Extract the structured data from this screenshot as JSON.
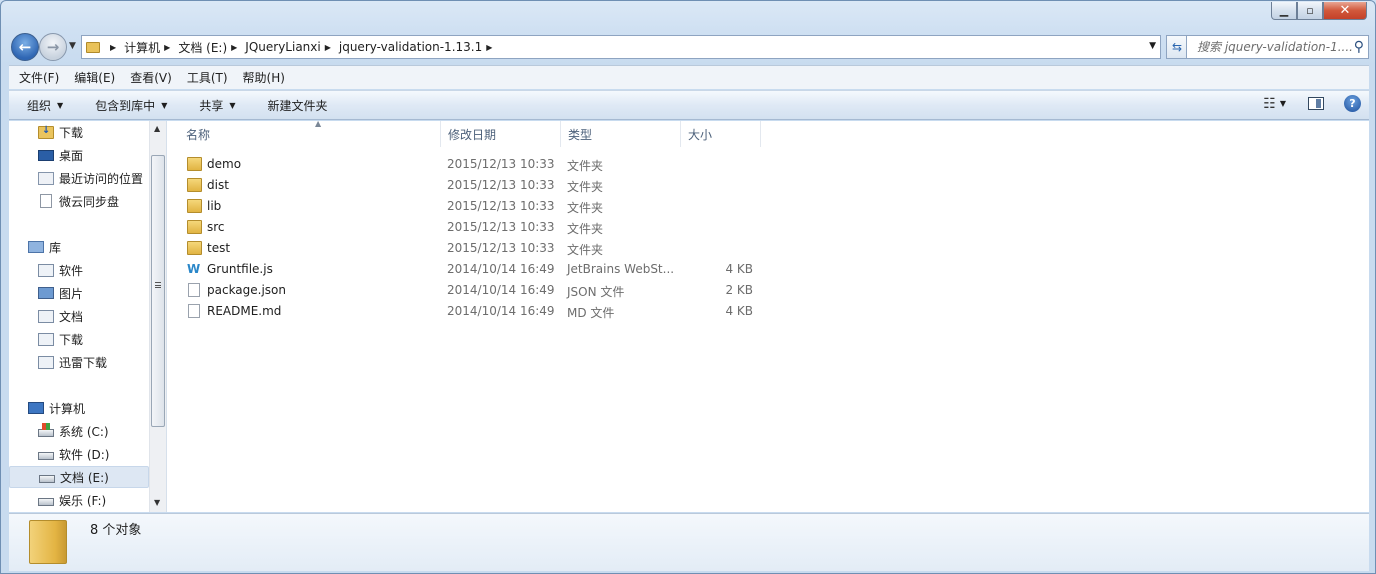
{
  "breadcrumb": [
    "计算机",
    "文档 (E:)",
    "JQueryLianxi",
    "jquery-validation-1.13.1"
  ],
  "search": {
    "placeholder": "搜索 jquery-validation-1...."
  },
  "menu": [
    "文件(F)",
    "编辑(E)",
    "查看(V)",
    "工具(T)",
    "帮助(H)"
  ],
  "toolbar": {
    "organize": "组织",
    "include_in_library": "包含到库中",
    "share": "共享",
    "new_folder": "新建文件夹"
  },
  "nav_tree": [
    {
      "label": "下载",
      "icon": "download-folder-icon",
      "indent": 1
    },
    {
      "label": "桌面",
      "icon": "desktop-icon",
      "indent": 1
    },
    {
      "label": "最近访问的位置",
      "icon": "recent-places-icon",
      "indent": 1
    },
    {
      "label": "微云同步盘",
      "icon": "document-icon",
      "indent": 1
    },
    {
      "label": "库",
      "icon": "library-icon",
      "indent": 0,
      "gap": true
    },
    {
      "label": "软件",
      "icon": "library-item-icon",
      "indent": 1
    },
    {
      "label": "图片",
      "icon": "pictures-icon",
      "indent": 1
    },
    {
      "label": "文档",
      "icon": "library-item-icon",
      "indent": 1
    },
    {
      "label": "下载",
      "icon": "library-item-icon",
      "indent": 1
    },
    {
      "label": "迅雷下载",
      "icon": "library-item-icon",
      "indent": 1
    },
    {
      "label": "计算机",
      "icon": "computer-icon",
      "indent": 0,
      "gap": true
    },
    {
      "label": "系统 (C:)",
      "icon": "system-drive-icon",
      "indent": 1
    },
    {
      "label": "软件 (D:)",
      "icon": "drive-icon",
      "indent": 1
    },
    {
      "label": "文档 (E:)",
      "icon": "drive-icon",
      "indent": 1,
      "selected": true
    },
    {
      "label": "娱乐 (F:)",
      "icon": "drive-icon",
      "indent": 1
    }
  ],
  "columns": {
    "name": "名称",
    "date": "修改日期",
    "type": "类型",
    "size": "大小"
  },
  "files": [
    {
      "name": "demo",
      "date": "2015/12/13 10:33",
      "type": "文件夹",
      "size": "",
      "icon": "folder-icon"
    },
    {
      "name": "dist",
      "date": "2015/12/13 10:33",
      "type": "文件夹",
      "size": "",
      "icon": "folder-icon"
    },
    {
      "name": "lib",
      "date": "2015/12/13 10:33",
      "type": "文件夹",
      "size": "",
      "icon": "folder-icon"
    },
    {
      "name": "src",
      "date": "2015/12/13 10:33",
      "type": "文件夹",
      "size": "",
      "icon": "folder-icon"
    },
    {
      "name": "test",
      "date": "2015/12/13 10:33",
      "type": "文件夹",
      "size": "",
      "icon": "folder-icon"
    },
    {
      "name": "Gruntfile.js",
      "date": "2014/10/14 16:49",
      "type": "JetBrains WebSt...",
      "size": "4 KB",
      "icon": "webstorm-file-icon"
    },
    {
      "name": "package.json",
      "date": "2014/10/14 16:49",
      "type": "JSON 文件",
      "size": "2 KB",
      "icon": "file-icon"
    },
    {
      "name": "README.md",
      "date": "2014/10/14 16:49",
      "type": "MD 文件",
      "size": "4 KB",
      "icon": "file-icon"
    }
  ],
  "status": {
    "object_count": "8 个对象"
  }
}
